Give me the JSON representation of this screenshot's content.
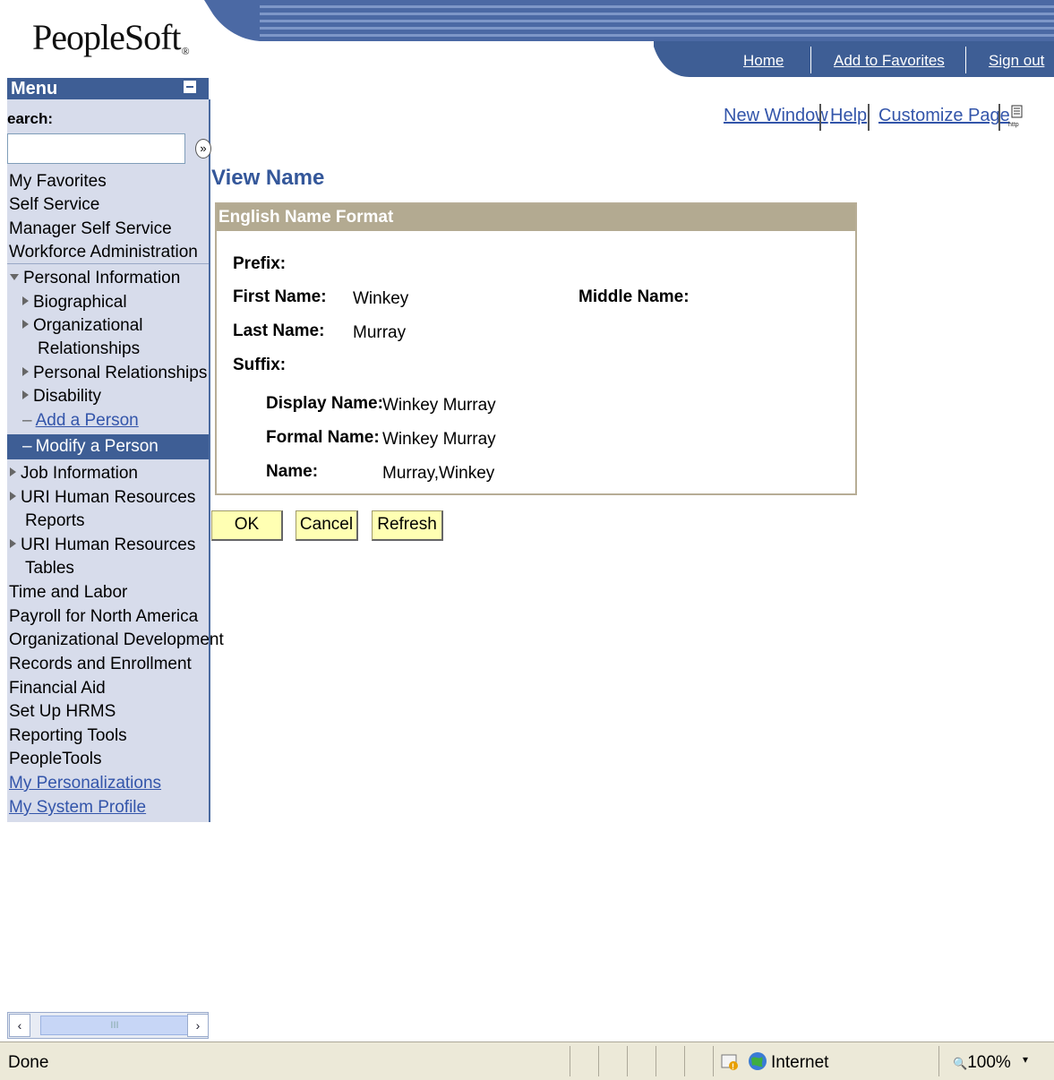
{
  "header": {
    "logo": "PeopleSoft",
    "links": [
      "Home",
      "Add to Favorites",
      "Sign out"
    ]
  },
  "menu": {
    "title": "Menu",
    "search_label": "earch:",
    "items": [
      "My Favorites",
      "Self Service",
      "Manager Self Service",
      "Workforce Administration",
      "Personal Information",
      "Biographical",
      "Organizational",
      "Relationships",
      "Personal Relationships",
      "Disability",
      "Add a Person",
      "Modify a Person",
      "Job Information",
      "URI Human Resources",
      "Reports",
      "URI Human Resources",
      "Tables",
      "Time and Labor",
      "Payroll for North America",
      "Organizational Development",
      "Records and Enrollment",
      "Financial Aid",
      "Set Up HRMS",
      "Reporting Tools",
      "PeopleTools",
      "My Personalizations",
      "My System Profile"
    ]
  },
  "toplinks": [
    "New Window",
    "Help",
    "Customize Page"
  ],
  "page": {
    "title": "View Name",
    "group_title": "English Name Format",
    "prefix_label": "Prefix:",
    "first_name_label": "First Name:",
    "first_name": "Winkey",
    "middle_name_label": "Middle Name:",
    "last_name_label": "Last Name:",
    "last_name": "Murray",
    "suffix_label": "Suffix:",
    "display_name_label": "Display Name:",
    "display_name": "Winkey Murray",
    "formal_name_label": "Formal Name:",
    "formal_name": "Winkey Murray",
    "name_label": "Name:",
    "name": "Murray,Winkey"
  },
  "buttons": {
    "ok": "OK",
    "cancel": "Cancel",
    "refresh": "Refresh"
  },
  "scrollbar": {
    "left_arrow": "‹",
    "right_arrow": "›",
    "grip": "III"
  },
  "statusbar": {
    "status": "Done",
    "zone": "Internet",
    "zoom": "100%",
    "zoom_arrow": "▾"
  },
  "colors": {
    "band": "#3e5e95",
    "menu_bg": "#d7dceb",
    "group_header": "#b3aa91",
    "button_bg": "#ffffb3"
  }
}
